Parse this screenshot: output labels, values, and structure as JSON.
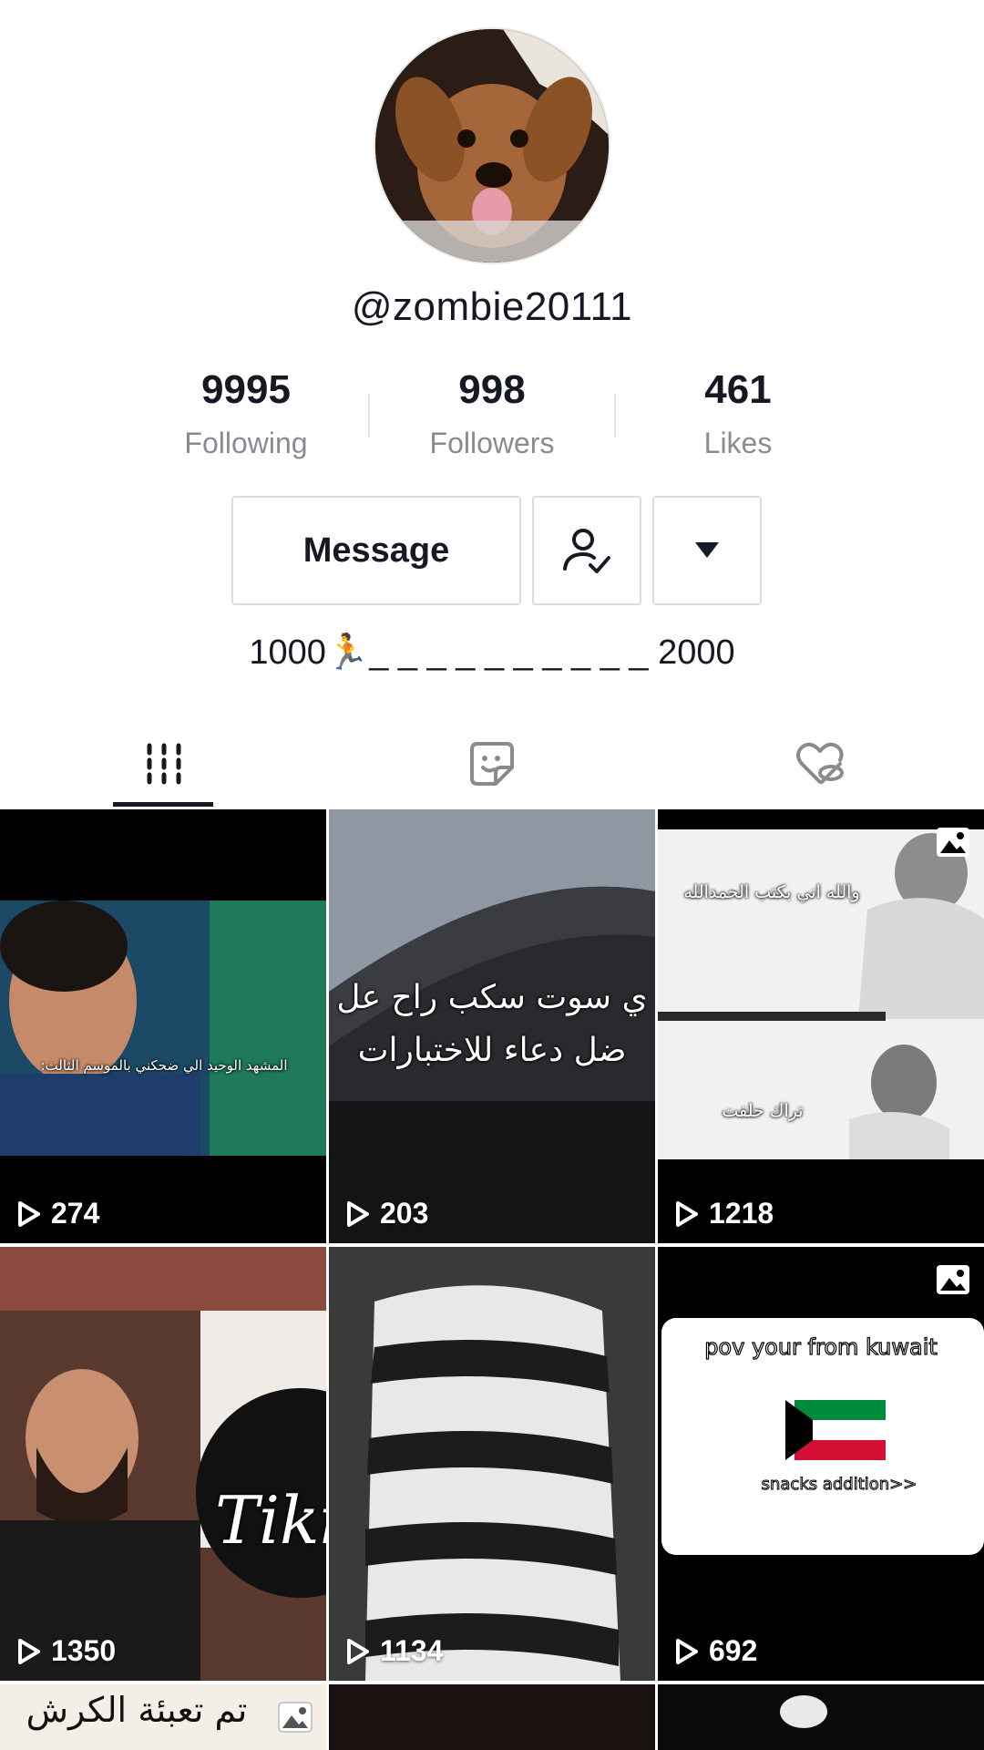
{
  "profile": {
    "username": "@zombie20111",
    "bio": "1000🏃_ _ _ _ _ _ _ _ _ _ 2000"
  },
  "stats": [
    {
      "value": "9995",
      "label": "Following"
    },
    {
      "value": "998",
      "label": "Followers"
    },
    {
      "value": "461",
      "label": "Likes"
    }
  ],
  "actions": {
    "message_label": "Message",
    "follow_icon": "user-check-icon",
    "more_icon": "triangle-down-icon"
  },
  "tabs": [
    {
      "icon": "grid-icon",
      "active": true
    },
    {
      "icon": "sticker-icon",
      "active": false
    },
    {
      "icon": "liked-hidden-icon",
      "active": false
    }
  ],
  "videos": [
    {
      "views": "274",
      "overlay": "المشهد الوحيد الي ضحكني بالموسم الثالث:"
    },
    {
      "views": "203",
      "overlay_1": "ي سوت سكب راح عل",
      "overlay_2": "ضل دعاء للاختبارات"
    },
    {
      "views": "1218",
      "overlay_1": "والله اني بكتب الحمدالله",
      "overlay_2": "تراك حلفت"
    },
    {
      "views": "1350",
      "overlay": "Tiki"
    },
    {
      "views": "1134"
    },
    {
      "views": "692",
      "overlay_1": "pov your from kuwait",
      "overlay_2": "snacks addition>>"
    },
    {
      "overlay": "تم تعبئة الكرش"
    },
    {},
    {}
  ],
  "colors": {
    "text": "#161823",
    "muted": "#8a8b91",
    "border": "#dcdcdc"
  }
}
